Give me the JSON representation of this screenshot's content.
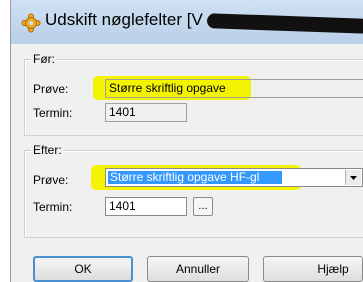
{
  "window": {
    "title": "Udskift nøglefelter [V",
    "title_icon": "gear-icon"
  },
  "before": {
    "legend": "Før:",
    "test_label": "Prøve:",
    "test_value": "Større skriftlig opgave",
    "term_label": "Termin:",
    "term_value": "1401"
  },
  "after": {
    "legend": "Efter:",
    "test_label": "Prøve:",
    "test_value": "Større skriftlig opgave HF-gl",
    "term_label": "Termin:",
    "term_value": "1401",
    "browse_label": "..."
  },
  "buttons": {
    "ok": "OK",
    "cancel": "Annuller",
    "help": "Hjælp"
  },
  "colors": {
    "highlight": "#f4f400",
    "selection": "#3399ff",
    "titlebar": "#c8dbf1"
  }
}
